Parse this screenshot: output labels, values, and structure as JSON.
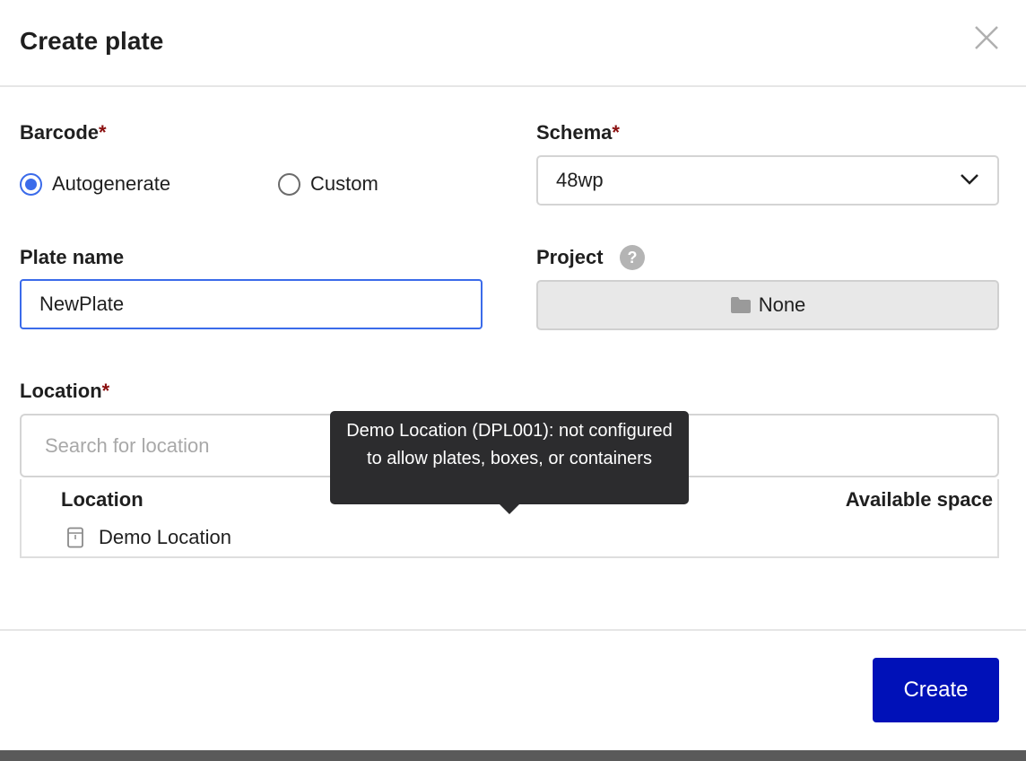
{
  "dialog": {
    "title": "Create plate"
  },
  "barcode": {
    "label": "Barcode",
    "required_mark": "*",
    "options": [
      {
        "label": "Autogenerate",
        "selected": true
      },
      {
        "label": "Custom",
        "selected": false
      }
    ]
  },
  "schema": {
    "label": "Schema",
    "required_mark": "*",
    "selected": "48wp"
  },
  "plate_name": {
    "label": "Plate name",
    "value": "NewPlate"
  },
  "project": {
    "label": "Project",
    "help_glyph": "?",
    "button_label": "None"
  },
  "location": {
    "label": "Location",
    "required_mark": "*",
    "search_placeholder": "Search for location",
    "columns": [
      "Location",
      "Available space"
    ],
    "rows": [
      {
        "name": "Demo Location",
        "icon": "storage-cabinet-icon"
      }
    ]
  },
  "tooltip": {
    "text": "Demo Location (DPL001): not configured to allow plates, boxes, or containers"
  },
  "footer": {
    "create_label": "Create"
  },
  "colors": {
    "accent": "#3b6bea",
    "primary_button": "#0011b8",
    "required": "#8a0f0f",
    "tooltip_bg": "#2c2c2e"
  }
}
